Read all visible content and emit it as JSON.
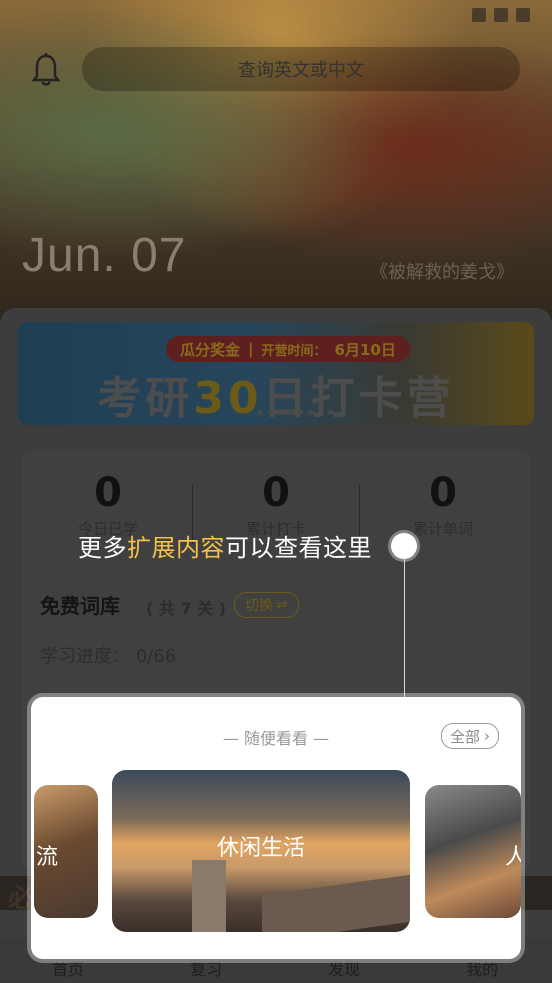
{
  "header": {
    "search_placeholder": "查询英文或中文",
    "date": "Jun. 07",
    "movie_title": "《被解救的姜戈》"
  },
  "banner": {
    "pill_bonus": "瓜分奖金",
    "pill_divider": "|",
    "pill_time_label": "开营时间：",
    "pill_time_value": "6月10日",
    "title_part1": "考研",
    "title_highlight": "30",
    "title_part2": "日打卡营"
  },
  "stats": [
    {
      "value": "0",
      "label": "今日已学"
    },
    {
      "value": "0",
      "label": "累计打卡"
    },
    {
      "value": "0",
      "label": "累计单词"
    }
  ],
  "library": {
    "title": "免费词库",
    "count": "( 共 7 关 )",
    "switch_label": "切换",
    "progress": "学习进度：  0/66"
  },
  "tabs": [
    "首页",
    "复习",
    "发现",
    "我的"
  ],
  "strip_text": "必",
  "guide": {
    "text_before": "更多",
    "text_highlight": "扩展内容",
    "text_after": "可以查看这里"
  },
  "panel": {
    "heading": "— 随便看看 —",
    "all_label": "全部",
    "cards": [
      {
        "title": "流"
      },
      {
        "title": "休闲生活"
      },
      {
        "title": "人"
      }
    ]
  },
  "colors": {
    "accent": "#f2c24a",
    "overlay": "#3d3d3d",
    "panel_bg": "#ffffff"
  }
}
